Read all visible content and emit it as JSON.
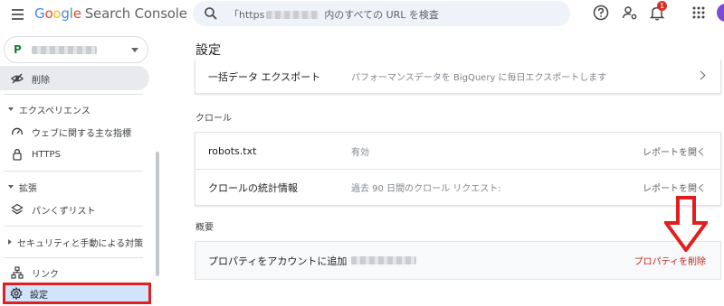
{
  "header": {
    "logo_google": [
      "G",
      "o",
      "o",
      "g",
      "l",
      "e"
    ],
    "logo_product": "Search Console",
    "search_prefix": "「https",
    "search_suffix": "内のすべての URL を検査",
    "notification_count": "1",
    "icons": [
      "menu-icon",
      "search-icon",
      "help-icon",
      "manage-users-icon",
      "bell-icon",
      "apps-icon"
    ]
  },
  "sidebar": {
    "property_prefix": "P",
    "top_item": "削除",
    "sections": [
      {
        "label": "エクスペリエンス",
        "items": [
          "ウェブに関する主な指標",
          "HTTPS"
        ]
      },
      {
        "label": "拡張",
        "items": [
          "パンくずリスト"
        ]
      },
      {
        "label": "セキュリティと手動による対策",
        "items": []
      }
    ],
    "bottom_items": [
      "リンク",
      "設定"
    ]
  },
  "main": {
    "title": "設定",
    "export_row": {
      "title": "一括データ エクスポート",
      "desc": "パフォーマンスデータを BigQuery に毎日エクスポートします"
    },
    "crawl_section": "クロール",
    "crawl_rows": [
      {
        "title": "robots.txt",
        "desc": "有効",
        "action": "レポートを開く"
      },
      {
        "title": "クロールの統計情報",
        "desc": "過去 90 日間のクロール リクエスト:",
        "action": "レポートを開く"
      }
    ],
    "overview_section": "概要",
    "overview_row": {
      "title": "プロパティをアカウントに追加",
      "action": "プロパティを削除"
    }
  },
  "colors": {
    "highlight_red": "#e02020",
    "danger_text": "#c5221f",
    "active_nav_bg": "#d2e3fc"
  }
}
